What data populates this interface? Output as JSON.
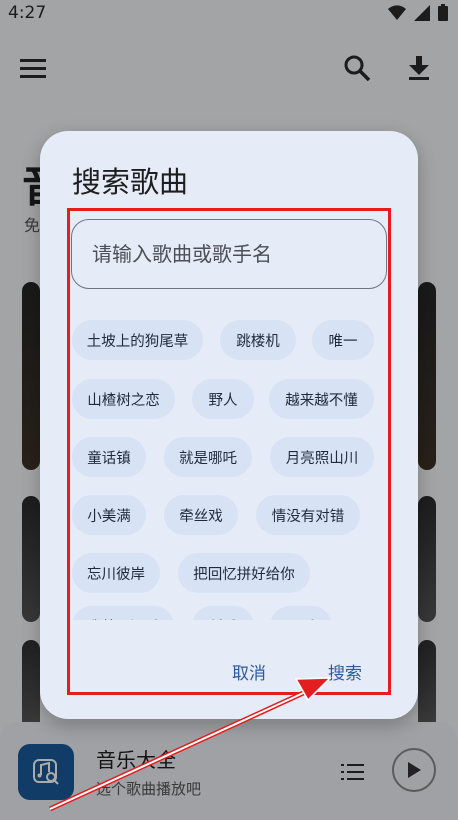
{
  "status": {
    "time": "4:27"
  },
  "appbar": {
    "icons": [
      "menu-icon",
      "search-icon",
      "download-icon"
    ]
  },
  "background": {
    "title_partial": "音",
    "subtitle_partial": "免"
  },
  "dialog": {
    "title": "搜索歌曲",
    "search_placeholder": "请输入歌曲或歌手名",
    "chips": [
      "土坡上的狗尾草",
      "跳楼机",
      "唯一",
      "山楂树之恋",
      "野人",
      "越来越不懂",
      "童话镇",
      "就是哪吒",
      "月亮照山川",
      "小美满",
      "牵丝戏",
      "情没有对错",
      "忘川彼岸",
      "把回忆拼好给你",
      "我曾用深爱",
      "稻香",
      "不爱"
    ],
    "cancel_label": "取消",
    "search_label": "搜索"
  },
  "player": {
    "title": "音乐大全",
    "subtitle": "选个歌曲播放吧"
  },
  "colors": {
    "dialog_bg": "#e5ebf7",
    "chip_bg": "#d8e2f5",
    "accent": "#2b5aa0",
    "highlight": "#e41e1e",
    "album_icon_bg": "#1a5a9a"
  }
}
